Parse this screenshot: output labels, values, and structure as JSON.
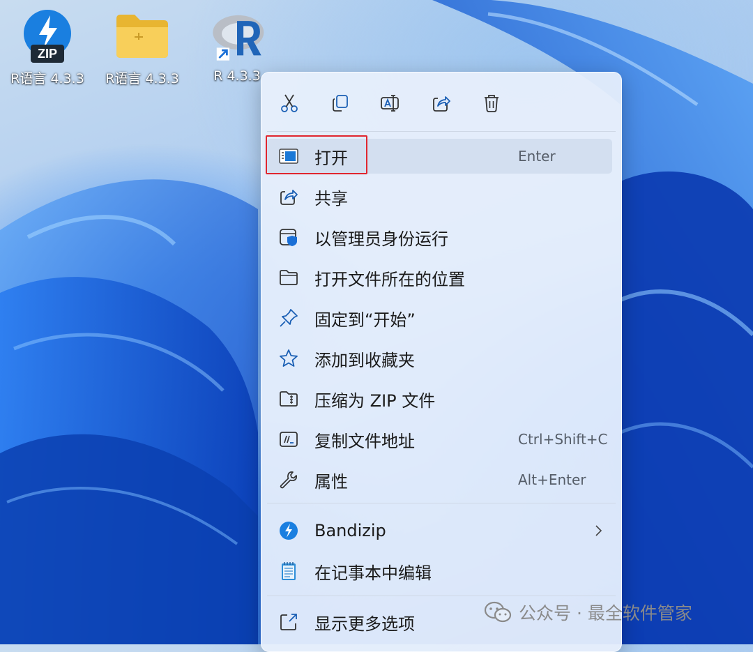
{
  "desktop": {
    "icons": [
      {
        "label": "R语言 4.3.3",
        "icon": "bandizip-zip-icon"
      },
      {
        "label": "R语言 4.3.3",
        "icon": "folder-icon"
      },
      {
        "label": "R 4.3.3",
        "icon": "r-logo-shortcut-icon"
      }
    ]
  },
  "context_menu": {
    "toolbar": [
      {
        "name": "cut",
        "icon": "scissors-icon"
      },
      {
        "name": "copy",
        "icon": "copy-icon"
      },
      {
        "name": "rename",
        "icon": "rename-icon"
      },
      {
        "name": "share",
        "icon": "share-icon"
      },
      {
        "name": "delete",
        "icon": "trash-icon"
      }
    ],
    "items": [
      {
        "label": "打开",
        "shortcut": "Enter",
        "icon": "open-app-icon",
        "highlighted": true
      },
      {
        "label": "共享",
        "shortcut": "",
        "icon": "share-icon"
      },
      {
        "label": "以管理员身份运行",
        "shortcut": "",
        "icon": "admin-shield-icon"
      },
      {
        "label": "打开文件所在的位置",
        "shortcut": "",
        "icon": "folder-outline-icon"
      },
      {
        "label": "固定到“开始”",
        "shortcut": "",
        "icon": "pin-icon"
      },
      {
        "label": "添加到收藏夹",
        "shortcut": "",
        "icon": "star-icon"
      },
      {
        "label": "压缩为 ZIP 文件",
        "shortcut": "",
        "icon": "zip-folder-icon"
      },
      {
        "label": "复制文件地址",
        "shortcut": "Ctrl+Shift+C",
        "icon": "copy-path-icon"
      },
      {
        "label": "属性",
        "shortcut": "Alt+Enter",
        "icon": "wrench-icon"
      },
      {
        "label": "Bandizip",
        "shortcut": "",
        "icon": "bandizip-icon",
        "submenu": true
      },
      {
        "label": "在记事本中编辑",
        "shortcut": "",
        "icon": "notepad-icon"
      },
      {
        "label": "显示更多选项",
        "shortcut": "",
        "icon": "more-options-icon"
      }
    ]
  },
  "watermark": {
    "text": "公众号 · 最全软件管家"
  },
  "colors": {
    "highlight_border": "#e0262f",
    "accent": "#0067c0"
  }
}
